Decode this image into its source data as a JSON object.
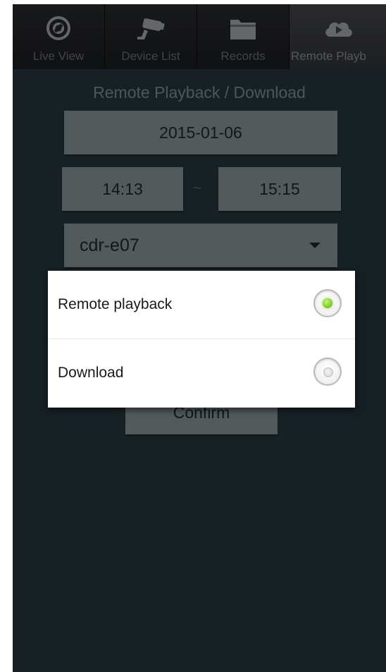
{
  "tabs": [
    {
      "label": "Live View",
      "icon": "live-view-icon",
      "active": false
    },
    {
      "label": "Device List",
      "icon": "camera-icon",
      "active": false
    },
    {
      "label": "Records",
      "icon": "folder-icon",
      "active": false
    },
    {
      "label": "Remote Playb",
      "icon": "cloud-play-icon",
      "active": true
    }
  ],
  "page": {
    "title": "Remote Playback / Download",
    "date": "2015-01-06",
    "time_start": "14:13",
    "time_separator": "~",
    "time_end": "15:15",
    "device": "cdr-e07",
    "confirm_label": "Confirm"
  },
  "dialog": {
    "options": [
      {
        "label": "Remote playback",
        "selected": true
      },
      {
        "label": "Download",
        "selected": false
      }
    ]
  },
  "colors": {
    "background": "#2a3d44",
    "button": "#96a4a8",
    "radio_selected": "#7fd11e"
  }
}
